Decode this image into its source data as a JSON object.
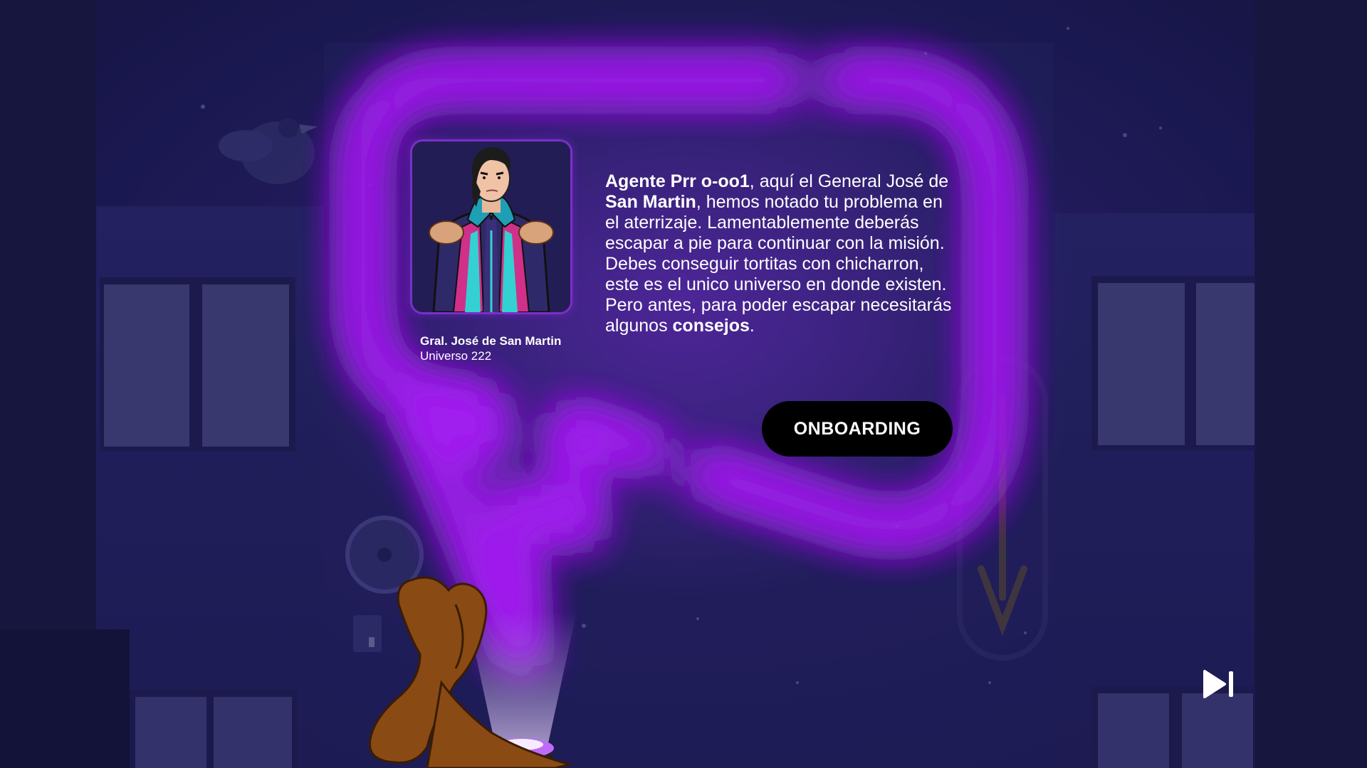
{
  "portrait": {
    "name": "Gral. José de San Martin",
    "universe": "Universo 222"
  },
  "dialogue": {
    "p1_bold": "Agente Prr o-oo1",
    "p2": ", aquí el General José de ",
    "p3_bold": "San Martin",
    "p4": ", hemos notado tu problema en el aterrizaje. Lamentablemente deberás escapar a pie para continuar con la misión. Debes conseguir tortitas con chicharron, este es el unico universo en donde existen. Pero antes, para poder escapar necesitarás algunos ",
    "p5_bold": "consejos",
    "p6": "."
  },
  "buttons": {
    "onboarding_label": "ONBOARDING"
  },
  "icons": {
    "skip": "skip-next-icon",
    "character": "dog-character-icon",
    "portrait": "general-san-martin-portrait-icon",
    "beacon": "hologram-beacon-icon",
    "bird": "bird-icon"
  },
  "colors": {
    "neon": "#b02cf5",
    "neon_core": "#fde8ef",
    "background": "#1a1850",
    "button": "#000000"
  }
}
